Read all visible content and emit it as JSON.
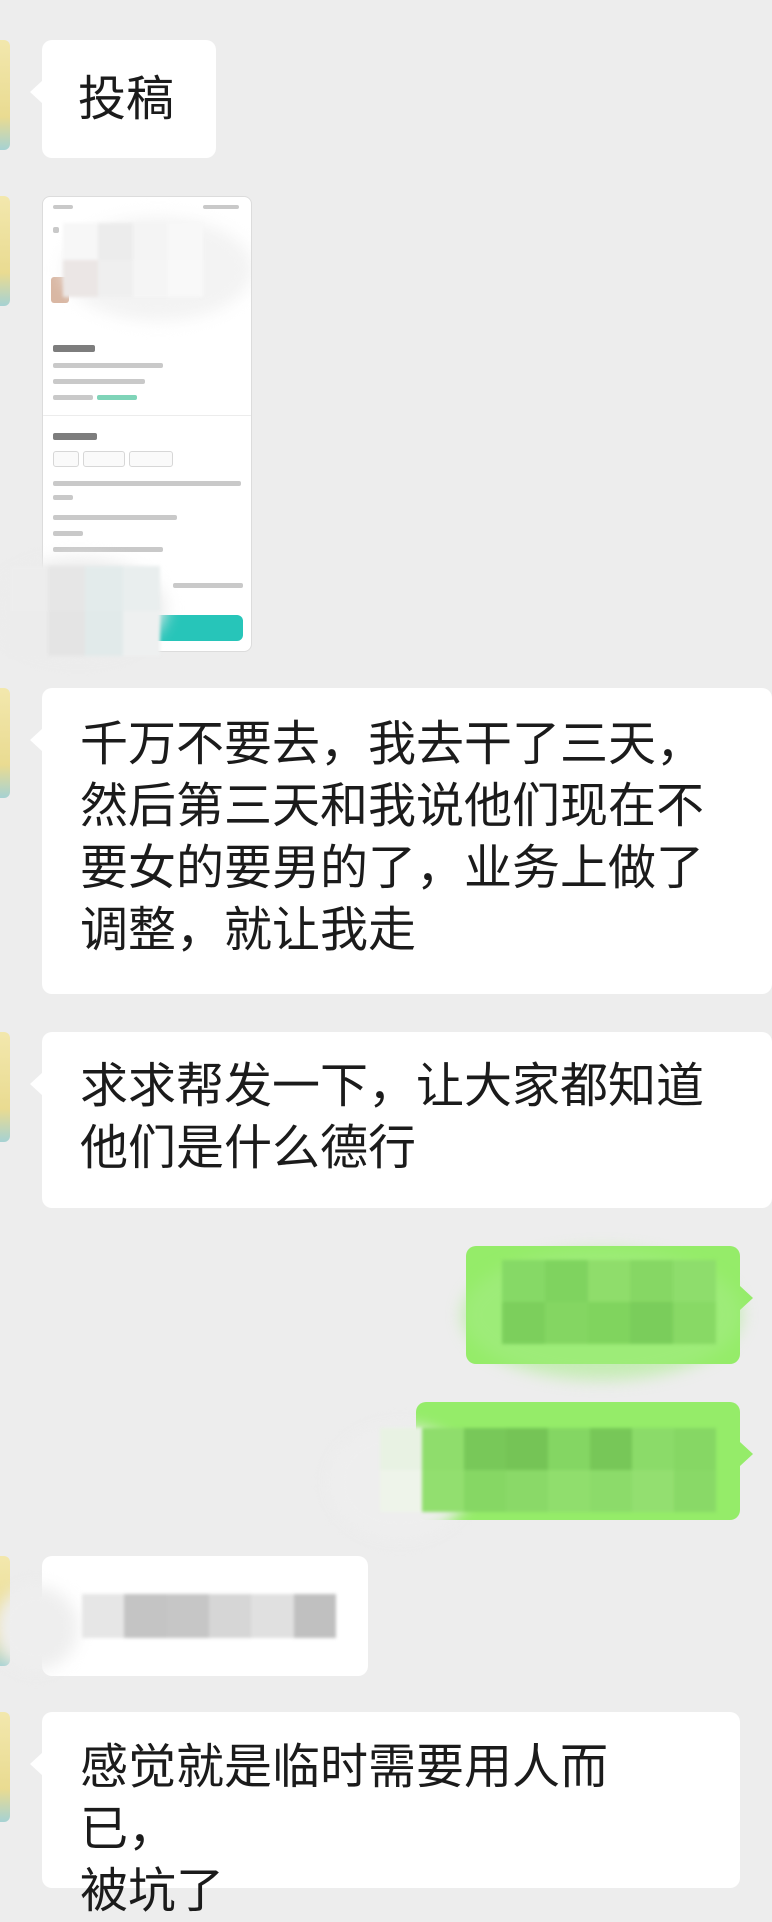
{
  "messages": [
    {
      "direction": "in",
      "type": "text",
      "text": "投稿"
    },
    {
      "direction": "in",
      "type": "image",
      "image_alt": "job-posting-screenshot"
    },
    {
      "direction": "in",
      "type": "text",
      "lines": [
        "千万不要去，我去干了三天，",
        "然后第三天和我说他们现在不",
        "要女的要男的了，业务上做了",
        "调整，就让我走"
      ]
    },
    {
      "direction": "in",
      "type": "text",
      "lines": [
        "求求帮发一下，让大家都知道",
        "他们是什么德行"
      ]
    },
    {
      "direction": "out",
      "type": "text",
      "redacted": true
    },
    {
      "direction": "out",
      "type": "text",
      "redacted": true
    },
    {
      "direction": "in",
      "type": "text",
      "redacted": true
    },
    {
      "direction": "in",
      "type": "text",
      "lines": [
        "感觉就是临时需要用人而已，",
        "被坑了"
      ]
    }
  ],
  "colors": {
    "background": "#ededed",
    "incoming_bubble": "#ffffff",
    "outgoing_bubble": "#95ec69",
    "thumbnail_button": "#27c5b9"
  }
}
